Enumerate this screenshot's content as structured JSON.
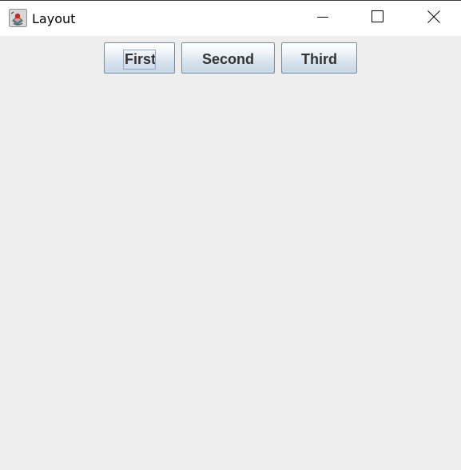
{
  "window": {
    "title": "Layout",
    "icon": "java-coffee-cup-icon",
    "controls": {
      "minimize": "minimize-icon",
      "maximize": "maximize-icon",
      "close": "close-icon"
    }
  },
  "buttons": [
    {
      "label": "First",
      "focused": true
    },
    {
      "label": "Second",
      "focused": false
    },
    {
      "label": "Third",
      "focused": false
    }
  ],
  "colors": {
    "content_background": "#eeeeee",
    "titlebar_background": "#ffffff",
    "button_text": "#333333",
    "button_border": "#7a8a99"
  }
}
